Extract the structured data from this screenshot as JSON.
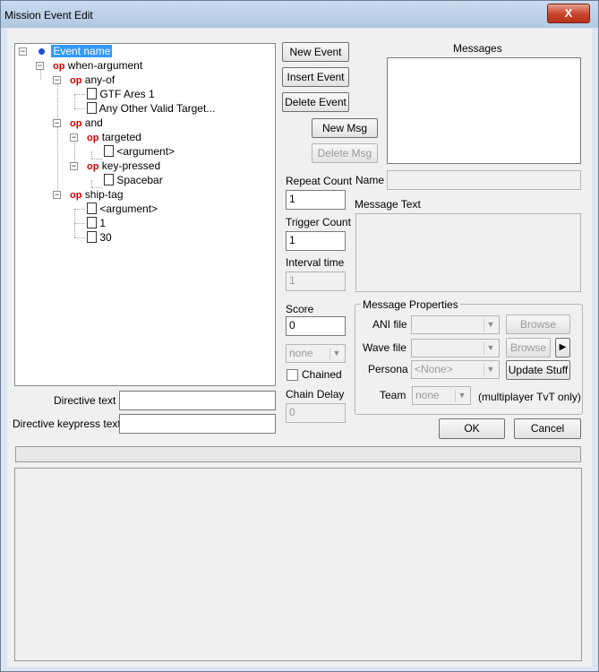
{
  "window": {
    "title": "Mission Event Edit",
    "close_label": "X"
  },
  "tree": {
    "root_label": "Event name",
    "when_argument": "when-argument",
    "any_of": "any-of",
    "ship1": "GTF Ares 1",
    "ship2": "Any Other Valid Target...",
    "and": "and",
    "targeted": "targeted",
    "argument1": "<argument>",
    "key_pressed": "key-pressed",
    "spacebar": "Spacebar",
    "ship_tag": "ship-tag",
    "argument2": "<argument>",
    "one": "1",
    "thirty": "30",
    "op_label": "op"
  },
  "buttons": {
    "new_event": "New Event",
    "insert_event": "Insert Event",
    "delete_event": "Delete Event",
    "new_msg": "New Msg",
    "delete_msg": "Delete Msg",
    "browse1": "Browse",
    "browse2": "Browse",
    "update_stuff": "Update Stuff",
    "ok": "OK",
    "cancel": "Cancel"
  },
  "fields": {
    "repeat_count_label": "Repeat Count",
    "repeat_count": "1",
    "trigger_count_label": "Trigger Count",
    "trigger_count": "1",
    "interval_label": "Interval time",
    "interval": "1",
    "score_label": "Score",
    "score": "0",
    "team_combo": "none",
    "chained_label": "Chained",
    "chain_delay_label": "Chain Delay",
    "chain_delay": "0",
    "directive_text_label": "Directive text",
    "directive_keypress_label": "Directive keypress text"
  },
  "messages": {
    "title": "Messages",
    "name_label": "Name",
    "message_text_label": "Message Text",
    "properties_title": "Message Properties",
    "ani_label": "ANI file",
    "wave_label": "Wave file",
    "persona_label": "Persona",
    "persona_value": "<None>",
    "team_label": "Team",
    "team_value": "none",
    "multiplayer_note": "(multiplayer TvT only)"
  },
  "colors": {
    "operator": "#d40000",
    "selection": "#3399ff",
    "title_bar": "#b2c8e2",
    "close_button": "#c6432a"
  }
}
